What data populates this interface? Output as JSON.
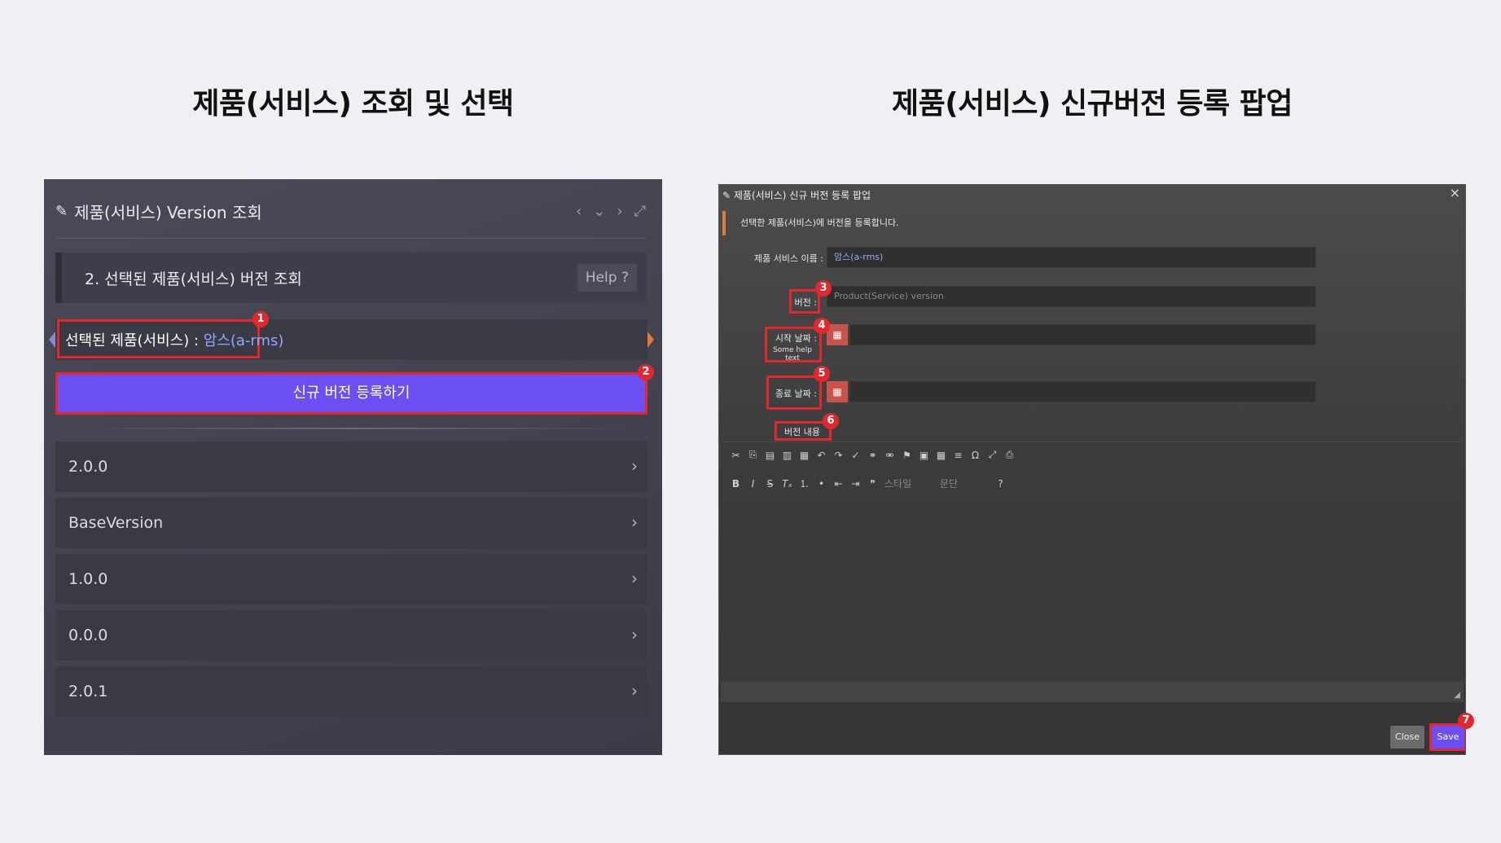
{
  "titles": {
    "left": "제품(서비스) 조회 및 선택",
    "right": "제품(서비스) 신규버전 등록 팝업"
  },
  "left_panel": {
    "header_title": "제품(서비스) Version 조회",
    "header_icon": "edit-icon",
    "subheader": "2. 선택된 제품(서비스) 버전 조회",
    "help_label": "Help ?",
    "selected_label": "선택된 제품(서비스) : ",
    "selected_value": "암스(a-rms)",
    "new_version_button": "신규 버전 등록하기",
    "versions": [
      "2.0.0",
      "BaseVersion",
      "1.0.0",
      "0.0.0",
      "2.0.1"
    ]
  },
  "badges": [
    "1",
    "2",
    "3",
    "4",
    "5",
    "6",
    "7"
  ],
  "popup": {
    "title": "제품(서비스) 신규 버전 등록 팝업",
    "close_icon": "×",
    "description": "선택한 제품(서비스)에 버전을 등록합니다.",
    "product_name_label": "제품 서비스 이름 :",
    "product_name_value": "암스(a-rms)",
    "version_label": "버전 :",
    "version_placeholder": "Product(Service) version",
    "start_date_label": "시작 날짜 :",
    "start_date_help": "Some help text",
    "end_date_label": "종료 날짜 :",
    "content_label": "버전 내용",
    "toolbar_style": "스타일",
    "toolbar_format": "문단",
    "toolbar_help": "?",
    "close_button": "Close",
    "save_button": "Save"
  },
  "colors": {
    "accent_purple": "#6b4ff2",
    "highlight_red": "#e3272c",
    "link_blue": "#94a7ff"
  }
}
